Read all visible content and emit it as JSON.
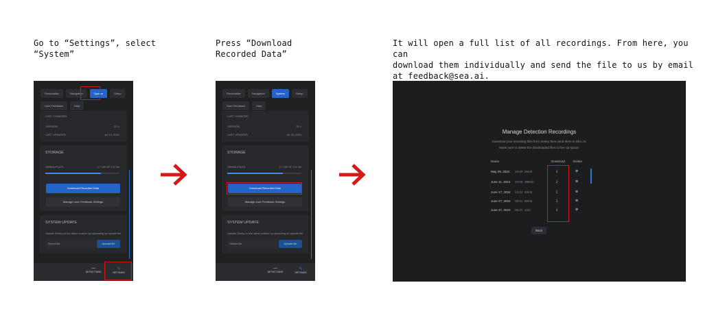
{
  "steps": [
    {
      "caption_line1": "Go to “Settings”, select",
      "caption_line2": "“System”"
    },
    {
      "caption_line1": "Press “Download",
      "caption_line2": "Recorded Data”"
    },
    {
      "caption_line1": "It will open a full list of all recordings. From here, you can",
      "caption_line2": "download them individually and send the file to us by email",
      "caption_line3": "at feedback@sea.ai."
    }
  ],
  "phone": {
    "tabs": [
      "Personalize",
      "Navigation",
      "System",
      "Setup"
    ],
    "tabs_row2": [
      "User Feedback",
      "Help"
    ],
    "last_changed_label": "LAST CHANGED",
    "version_label": "VERSION",
    "version_value": "23.4",
    "last_updated_label": "LAST UPDATED",
    "last_updated_value": "Jul 15, 2024",
    "storage_title": "STORAGE",
    "storage_label": "SERIAL/FILES",
    "storage_value": "2.7 GB OF 2.5 GB",
    "storage_fill": 0.75,
    "download_button": "Download Recorded Data",
    "manage_button": "Manage User Feedback Settings",
    "update_title": "SYSTEM UPDATE",
    "update_desc": "Update Sentry to the latest version by uploading an update file",
    "select_file": "Select file",
    "upload_button": "Upload file",
    "nav_detections": "DETECTIONS",
    "nav_settings": "SETTINGS"
  },
  "recordings": {
    "title": "Manage Detection Recordings",
    "subtitle_line1": "Download your recording files from Sentry then send them to SEA.AI.",
    "subtitle_line2": "Make sure to delete the downloaded files to free up space.",
    "col_name": "Name",
    "col_download": "Download",
    "col_delete": "Delete",
    "rows": [
      {
        "date": "May 29, 2024",
        "time": "16:40",
        "size": "29mb"
      },
      {
        "date": "June 11, 2024",
        "time": "10:09",
        "size": "396mb"
      },
      {
        "date": "June 17, 2024",
        "time": "13:34",
        "size": "83mb"
      },
      {
        "date": "June 27, 2024",
        "time": "08:31",
        "size": "60mb"
      },
      {
        "date": "June 27, 2024",
        "time": "08:31",
        "size": "1mb"
      }
    ],
    "back_button": "Back"
  },
  "colors": {
    "highlight": "#d11b1b",
    "accent": "#2463c7",
    "arrow": "#d11b1b"
  }
}
